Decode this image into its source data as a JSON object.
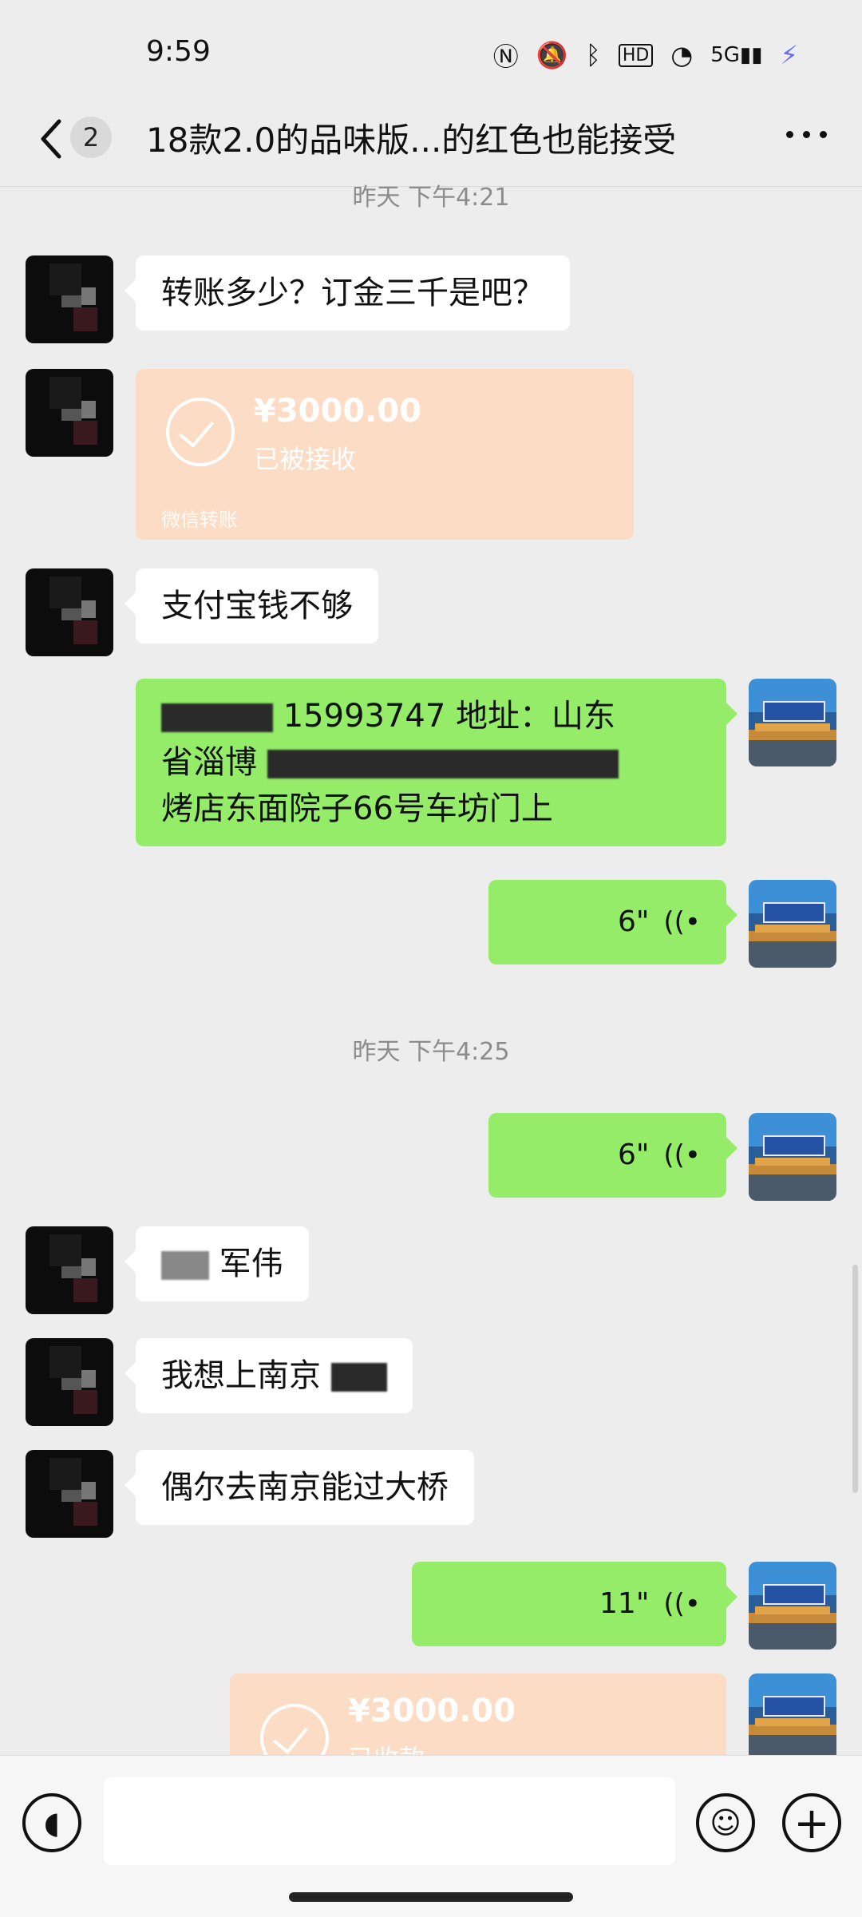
{
  "status_bar": {
    "time": "9:59",
    "icons": [
      "nfc-icon",
      "mute-icon",
      "bluetooth-icon",
      "hd-icon",
      "wifi-icon",
      "5g-signal-icon",
      "charging-icon"
    ]
  },
  "header": {
    "back_count": "2",
    "title": "18款2.0的品味版...的红色也能接受"
  },
  "timestamps": {
    "t1": "昨天 下午4:21",
    "t2": "昨天 下午4:25"
  },
  "messages": {
    "m1": "转账多少？订金三千是吧？",
    "transfer1": {
      "amount": "¥3000.00",
      "status": "已被接收",
      "footer": "微信转账"
    },
    "m2": "支付宝钱不够",
    "m3_line1_visible": "15993747 地址：山东",
    "m3_line2": "省淄博",
    "m3_line3": "烤店东面院子66号车坊门上",
    "voice1": "6\"",
    "voice2": "6\"",
    "m4": "军伟",
    "m5": "我想上南京",
    "m6": "偶尔去南京能过大桥",
    "voice3": "11\"",
    "transfer2": {
      "amount": "¥3000.00",
      "status": "已收款"
    }
  },
  "colors": {
    "background": "#ededed",
    "self_bubble": "#95ec69",
    "other_bubble": "#ffffff",
    "transfer": "#fcdcc4"
  }
}
